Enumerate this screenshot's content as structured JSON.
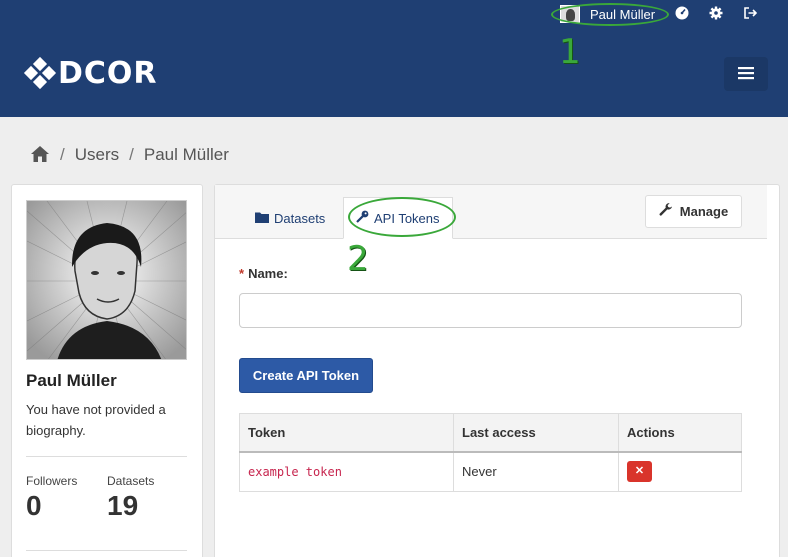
{
  "header": {
    "user_name": "Paul Müller",
    "logo_text": "DCOR",
    "icons": [
      "dashboard-icon",
      "gear-icon",
      "logout-icon",
      "hamburger-menu-icon"
    ]
  },
  "breadcrumb": {
    "items": [
      "Users",
      "Paul Müller"
    ]
  },
  "profile": {
    "name": "Paul Müller",
    "bio": "You have not provided a biography.",
    "followers_label": "Followers",
    "followers_value": "0",
    "datasets_label": "Datasets",
    "datasets_value": "19"
  },
  "tabs": [
    {
      "label": "Datasets",
      "icon": "folder-icon"
    },
    {
      "label": "API Tokens",
      "icon": "key-icon"
    }
  ],
  "manage_label": "Manage",
  "form": {
    "name_label": "Name:",
    "required_mark": "*",
    "name_value": "",
    "create_label": "Create API Token"
  },
  "table": {
    "headers": [
      "Token",
      "Last access",
      "Actions"
    ],
    "rows": [
      {
        "token": "example token",
        "last_access": "Never",
        "action_icon": "delete-icon"
      }
    ]
  },
  "annotations": {
    "one": "1",
    "two": "2"
  },
  "colors": {
    "header_bg": "#1f3f73",
    "primary": "#2d5aa6",
    "danger": "#d9342b",
    "annotation": "#3aa83a"
  }
}
